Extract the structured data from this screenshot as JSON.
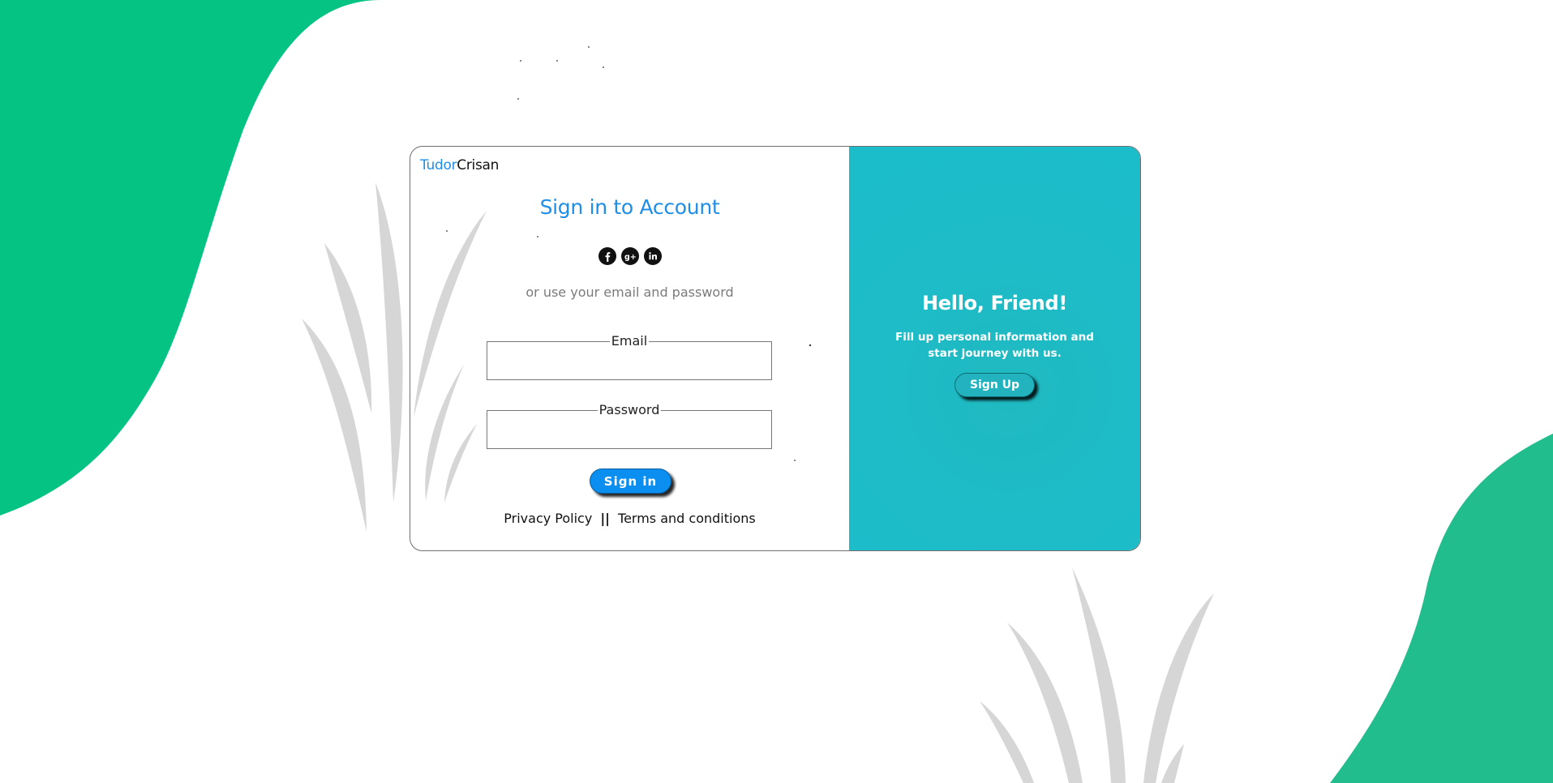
{
  "colors": {
    "primary_blue": "#1f8ee6",
    "panel_teal": "#1ebcc8",
    "blob_green": "#04c383",
    "blob_green_right": "#22bd8c",
    "grass_gray": "#d7d7d7"
  },
  "brand": {
    "part1": "Tudor",
    "part2": "Crisan"
  },
  "signin": {
    "title": "Sign in to Account",
    "social_icons": [
      "facebook-icon",
      "google-plus-icon",
      "linkedin-icon"
    ],
    "subtitle": "or use your email and password",
    "email_label": "Email",
    "email_value": "",
    "password_label": "Password",
    "password_value": "",
    "button_label": "Sign in"
  },
  "footer_links": {
    "privacy": "Privacy Policy",
    "separator": "||",
    "terms": "Terms and conditions"
  },
  "signup_panel": {
    "title": "Hello, Friend!",
    "text": "Fill up personal information and start journey with us.",
    "button_label": "Sign Up"
  }
}
